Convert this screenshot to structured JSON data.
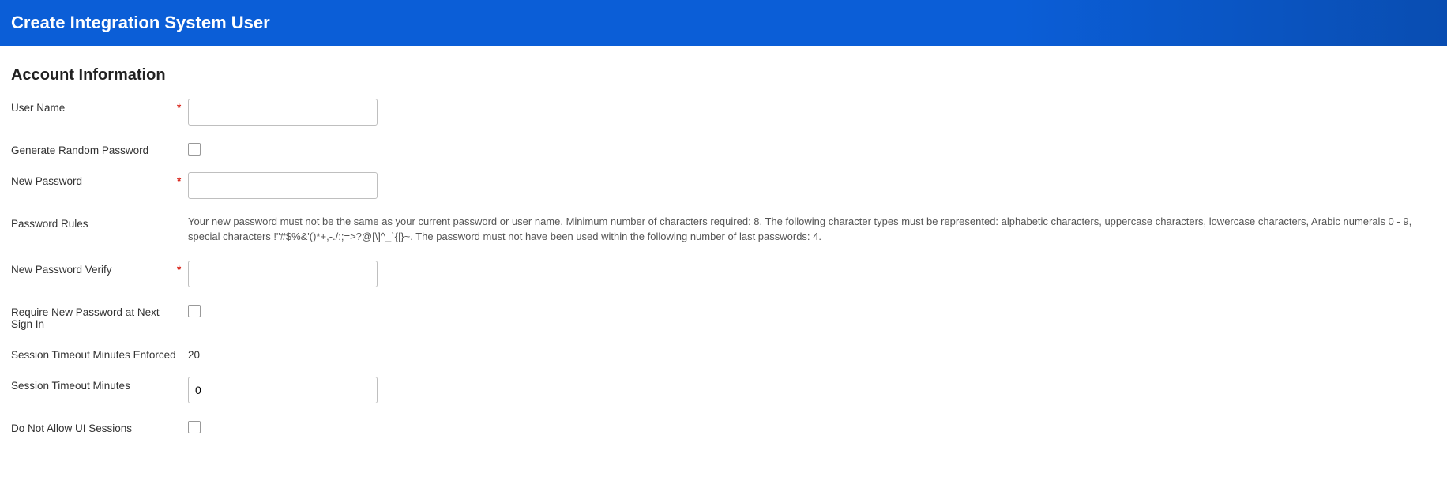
{
  "header": {
    "title": "Create Integration System User"
  },
  "section": {
    "title": "Account Information"
  },
  "fields": {
    "username": {
      "label": "User Name",
      "required": "*",
      "value": ""
    },
    "generate_random": {
      "label": "Generate Random Password"
    },
    "new_password": {
      "label": "New Password",
      "required": "*",
      "value": ""
    },
    "password_rules": {
      "label": "Password Rules",
      "text": "Your new password must not be the same as your current password or user name. Minimum number of characters required: 8. The following character types must be represented: alphabetic characters, uppercase characters, lowercase characters, Arabic numerals 0 - 9, special characters !\"#$%&'()*+,-./:;=>?@[\\]^_`{|}~.  The password must not have been used within the following number of last passwords: 4."
    },
    "new_password_verify": {
      "label": "New Password Verify",
      "required": "*",
      "value": ""
    },
    "require_new_at_signin": {
      "label": "Require New Password at Next Sign In"
    },
    "session_timeout_enforced": {
      "label": "Session Timeout Minutes Enforced",
      "value": "20"
    },
    "session_timeout_minutes": {
      "label": "Session Timeout Minutes",
      "value": "0"
    },
    "do_not_allow_ui": {
      "label": "Do Not Allow UI Sessions"
    }
  }
}
